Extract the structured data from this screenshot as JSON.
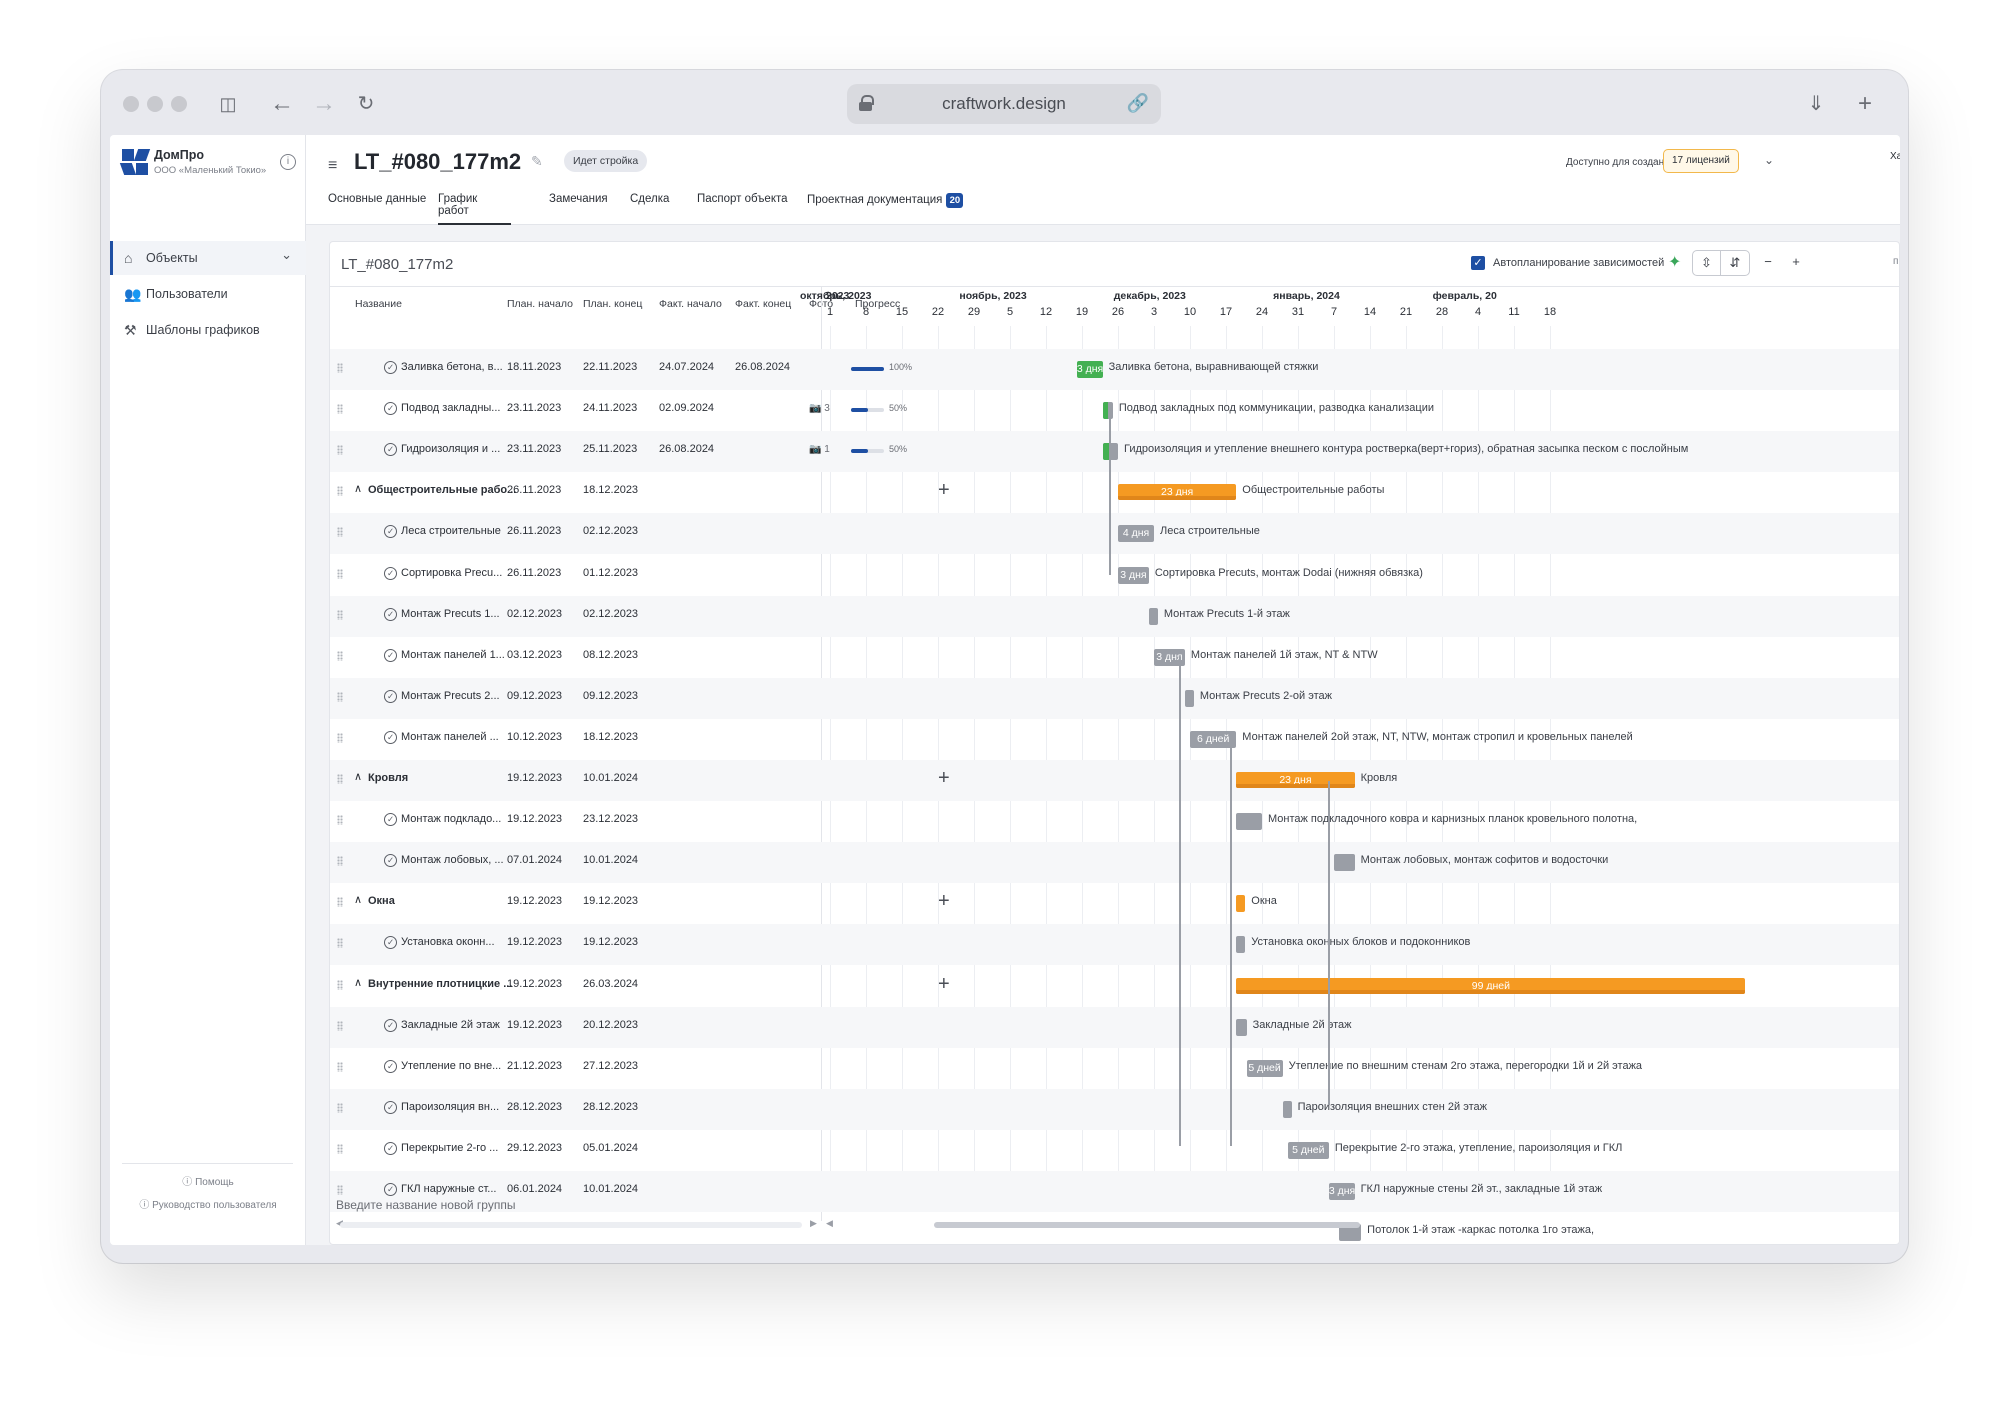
{
  "browser": {
    "url": "craftwork.design"
  },
  "sidebar": {
    "brand": "ДомПро",
    "brand_sub": "ООО «Маленький Токио»",
    "items": [
      {
        "label": "Объекты",
        "icon": "home-icon"
      },
      {
        "label": "Пользователи",
        "icon": "users-icon"
      },
      {
        "label": "Шаблоны графиков",
        "icon": "tools-icon"
      }
    ],
    "help": "Помощь",
    "guide": "Руководство пользователя"
  },
  "header": {
    "title": "LT_#080_177m2",
    "status": "Идет стройка",
    "available_label": "Доступно для создания:",
    "licenses": "17 лицензий",
    "user_short": "Ха",
    "tabs": [
      {
        "label": "Основные данные",
        "active": false
      },
      {
        "label": "График работ",
        "active": true
      },
      {
        "label": "Замечания",
        "active": false
      },
      {
        "label": "Сделка",
        "active": false
      },
      {
        "label": "Паспорт объекта",
        "active": false
      },
      {
        "label": "Проектная документация",
        "active": false,
        "badge": "20"
      }
    ]
  },
  "schedule": {
    "title": "LT_#080_177m2",
    "autoplan_label": "Автопланирование зависимостей",
    "autoplan_checked": true,
    "more": "п",
    "columns": [
      "Название",
      "План. начало",
      "План. конец",
      "Факт. начало",
      "Факт. конец",
      "Фото",
      "Прогресс"
    ],
    "new_group_placeholder": "Введите название новой группы",
    "rows": [
      {
        "type": "task",
        "name": "Заливка бетона, в...",
        "plan_start": "18.11.2023",
        "plan_end": "22.11.2023",
        "fact_start": "24.07.2024",
        "fact_end": "26.08.2024",
        "photos": "",
        "progress": 100,
        "progress_text": "100%",
        "bar_text": "3 дня",
        "full_name": "Заливка бетона, выравнивающей стяжки"
      },
      {
        "type": "task",
        "name": "Подвод закладны...",
        "plan_start": "23.11.2023",
        "plan_end": "24.11.2023",
        "fact_start": "02.09.2024",
        "fact_end": "",
        "photos": "3",
        "progress": 50,
        "progress_text": "50%",
        "bar_text": "",
        "full_name": "Подвод закладных под коммуникации, разводка канализации"
      },
      {
        "type": "task",
        "name": "Гидроизоляция и ...",
        "plan_start": "23.11.2023",
        "plan_end": "25.11.2023",
        "fact_start": "26.08.2024",
        "fact_end": "",
        "photos": "1",
        "progress": 50,
        "progress_text": "50%",
        "bar_text": "",
        "full_name": "Гидроизоляция и утепление внешнего контура ростверка(верт+гориз), обратная засыпка песком с послойным"
      },
      {
        "type": "group",
        "name": "Общестроительные рабо...",
        "plan_start": "26.11.2023",
        "plan_end": "18.12.2023",
        "bar_text": "23 дня",
        "full_name": "Общестроительные работы"
      },
      {
        "type": "task",
        "name": "Леса строительные",
        "plan_start": "26.11.2023",
        "plan_end": "02.12.2023",
        "bar_text": "4 дня",
        "full_name": "Леса строительные"
      },
      {
        "type": "task",
        "name": "Сортировка Precu...",
        "plan_start": "26.11.2023",
        "plan_end": "01.12.2023",
        "bar_text": "3 дня",
        "full_name": "Сортировка Precuts, монтаж Dodai (нижняя обвязка)"
      },
      {
        "type": "task",
        "name": "Монтаж Precuts 1...",
        "plan_start": "02.12.2023",
        "plan_end": "02.12.2023",
        "bar_text": "",
        "full_name": "Монтаж Precuts 1-й этаж"
      },
      {
        "type": "task",
        "name": "Монтаж панелей 1...",
        "plan_start": "03.12.2023",
        "plan_end": "08.12.2023",
        "bar_text": "3 дня",
        "full_name": "Монтаж панелей 1й этаж, NT & NTW"
      },
      {
        "type": "task",
        "name": "Монтаж Precuts 2...",
        "plan_start": "09.12.2023",
        "plan_end": "09.12.2023",
        "bar_text": "",
        "full_name": "Монтаж Precuts 2-ой этаж"
      },
      {
        "type": "task",
        "name": "Монтаж панелей ...",
        "plan_start": "10.12.2023",
        "plan_end": "18.12.2023",
        "bar_text": "6 дней",
        "full_name": "Монтаж панелей 2ой этаж, NT, NTW, монтаж стропил и кровельных панелей"
      },
      {
        "type": "group",
        "name": "Кровля",
        "plan_start": "19.12.2023",
        "plan_end": "10.01.2024",
        "bar_text": "23 дня",
        "full_name": "Кровля"
      },
      {
        "type": "task",
        "name": "Монтаж подкладо...",
        "plan_start": "19.12.2023",
        "plan_end": "23.12.2023",
        "bar_text": "",
        "full_name": "Монтаж подкладочного ковра и карнизных планок кровельного полотна,"
      },
      {
        "type": "task",
        "name": "Монтаж лобовых, ...",
        "plan_start": "07.01.2024",
        "plan_end": "10.01.2024",
        "bar_text": "",
        "full_name": "Монтаж лобовых, монтаж софитов и водосточки"
      },
      {
        "type": "group",
        "name": "Окна",
        "plan_start": "19.12.2023",
        "plan_end": "19.12.2023",
        "bar_text": "",
        "full_name": "Окна"
      },
      {
        "type": "task",
        "name": "Установка оконн...",
        "plan_start": "19.12.2023",
        "plan_end": "19.12.2023",
        "bar_text": "",
        "full_name": "Установка оконных блоков и подоконников"
      },
      {
        "type": "group",
        "name": "Внутренние плотницкие ...",
        "plan_start": "19.12.2023",
        "plan_end": "26.03.2024",
        "bar_text": "99 дней",
        "full_name": ""
      },
      {
        "type": "task",
        "name": "Закладные 2й этаж",
        "plan_start": "19.12.2023",
        "plan_end": "20.12.2023",
        "bar_text": "",
        "full_name": "Закладные 2й этаж"
      },
      {
        "type": "task",
        "name": "Утепление по вне...",
        "plan_start": "21.12.2023",
        "plan_end": "27.12.2023",
        "bar_text": "5 дней",
        "full_name": "Утепление по внешним стенам 2го этажа, перегородки 1й и 2й этажа"
      },
      {
        "type": "task",
        "name": "Пароизоляция вн...",
        "plan_start": "28.12.2023",
        "plan_end": "28.12.2023",
        "bar_text": "",
        "full_name": "Пароизоляция внешних стен 2й этаж"
      },
      {
        "type": "task",
        "name": "Перекрытие 2-го ...",
        "plan_start": "29.12.2023",
        "plan_end": "05.01.2024",
        "bar_text": "5 дней",
        "full_name": "Перекрытие 2-го этажа, утепление, пароизоляция и ГКЛ"
      },
      {
        "type": "task",
        "name": "ГКЛ наружные ст...",
        "plan_start": "06.01.2024",
        "plan_end": "10.01.2024",
        "bar_text": "3 дня",
        "full_name": "ГКЛ наружные стены 2й эт., закладные 1й этаж"
      },
      {
        "type": "task",
        "name": "",
        "plan_start": "",
        "plan_end": "",
        "bar_text": "",
        "full_name": "Потолок 1-й этаж -каркас потолка 1го этажа,"
      }
    ]
  },
  "timeline": {
    "months": [
      {
        "label": "2023",
        "date": "2023-09-25"
      },
      {
        "label": "октябрь, 2023",
        "date": "2023-10-01"
      },
      {
        "label": "ноябрь, 2023",
        "date": "2023-11-01"
      },
      {
        "label": "декабрь, 2023",
        "date": "2023-12-01"
      },
      {
        "label": "январь, 2024",
        "date": "2024-01-01"
      },
      {
        "label": "февраль, 20",
        "date": "2024-02-01"
      }
    ],
    "days": [
      {
        "label": "1",
        "date": "2023-10-01"
      },
      {
        "label": "8",
        "date": "2023-10-08"
      },
      {
        "label": "15",
        "date": "2023-10-15"
      },
      {
        "label": "22",
        "date": "2023-10-22"
      },
      {
        "label": "29",
        "date": "2023-10-29"
      },
      {
        "label": "5",
        "date": "2023-11-05"
      },
      {
        "label": "12",
        "date": "2023-11-12"
      },
      {
        "label": "19",
        "date": "2023-11-19"
      },
      {
        "label": "26",
        "date": "2023-11-26"
      },
      {
        "label": "3",
        "date": "2023-12-03"
      },
      {
        "label": "10",
        "date": "2023-12-10"
      },
      {
        "label": "17",
        "date": "2023-12-17"
      },
      {
        "label": "24",
        "date": "2023-12-24"
      },
      {
        "label": "31",
        "date": "2023-12-31"
      },
      {
        "label": "7",
        "date": "2024-01-07"
      },
      {
        "label": "14",
        "date": "2024-01-14"
      },
      {
        "label": "21",
        "date": "2024-01-21"
      },
      {
        "label": "28",
        "date": "2024-01-28"
      },
      {
        "label": "4",
        "date": "2024-02-04"
      },
      {
        "label": "11",
        "date": "2024-02-11"
      },
      {
        "label": "18",
        "date": "2024-02-18"
      }
    ]
  },
  "colors": {
    "accent": "#1e4fa3",
    "group_bar": "#f59a22",
    "task_bar": "#9a9ea6",
    "done_bar": "#43b052",
    "license_border": "#f2b84b"
  }
}
